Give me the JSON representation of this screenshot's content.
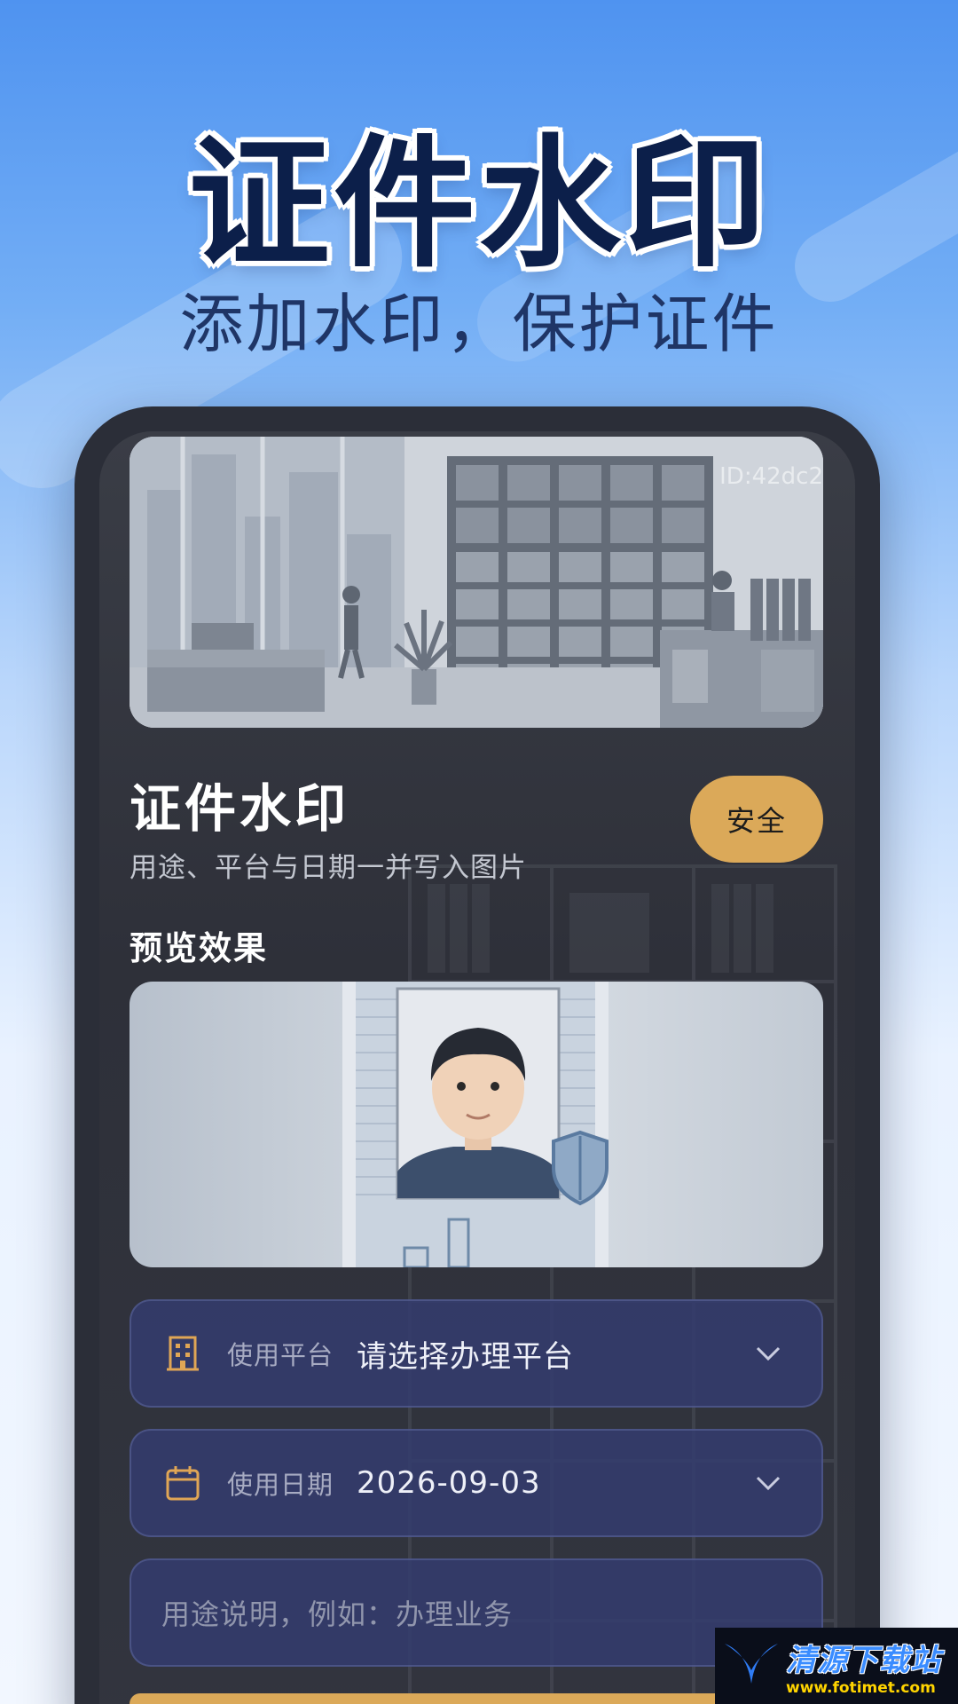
{
  "hero": {
    "title": "证件水印",
    "subtitle": "添加水印，保护证件"
  },
  "banner": {
    "id_text": "ID:42dc2"
  },
  "card": {
    "title": "证件水印",
    "description": "用途、平台与日期一并写入图片",
    "badge": "安全"
  },
  "preview": {
    "label": "预览效果"
  },
  "form": {
    "platform": {
      "icon": "building-icon",
      "label": "使用平台",
      "value": "请选择办理平台"
    },
    "date": {
      "icon": "calendar-icon",
      "label": "使用日期",
      "value": "2026-09-03"
    },
    "purpose": {
      "placeholder": "用途说明，例如：办理业务"
    }
  },
  "watermark": {
    "text": "清源下载站",
    "url": "www.fotimet.com"
  },
  "colors": {
    "accent": "#dba959",
    "hero_text": "#0c1f4a",
    "field_bg": "#343c6e"
  }
}
